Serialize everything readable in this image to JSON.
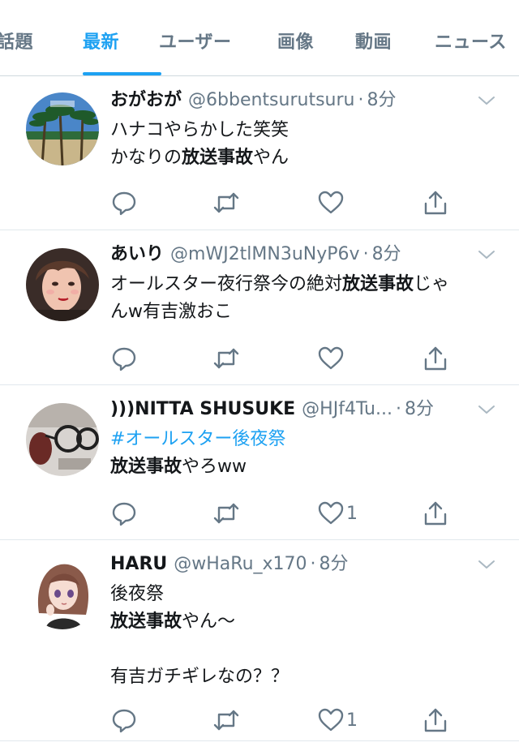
{
  "tabs": [
    {
      "label": "話題",
      "active": false
    },
    {
      "label": "最新",
      "active": true
    },
    {
      "label": "ユーザー",
      "active": false
    },
    {
      "label": "画像",
      "active": false
    },
    {
      "label": "動画",
      "active": false
    },
    {
      "label": "ニュース",
      "active": false
    }
  ],
  "colors": {
    "accent": "#1da1f2",
    "text": "#14171a",
    "muted": "#657786",
    "divider": "#e1e8ed"
  },
  "tweets": [
    {
      "name": "おがおが",
      "handle": "@6bbentsurutsuru",
      "separator": "·",
      "time": "8分",
      "avatar_icon": "palm-trees-beach-avatar",
      "lines": [
        {
          "a": "ハナコやらかした笑笑",
          "b": "",
          "c": ""
        },
        {
          "a": "かなりの",
          "b": "放送事故",
          "c": "やん"
        }
      ],
      "likes": ""
    },
    {
      "name": "あいり",
      "handle": "@mWJ2tlMN3uNyP6v",
      "separator": "·",
      "time": "8分",
      "avatar_icon": "woman-portrait-avatar",
      "lines": [
        {
          "a": "オールスター夜行祭今の絶対",
          "b": "放送事故",
          "c": "じゃ"
        },
        {
          "a": "んw有吉激おこ",
          "b": "",
          "c": ""
        }
      ],
      "likes": ""
    },
    {
      "name": ")))NITTA SHUSUKE",
      "handle": "@HJf4Tu...",
      "separator": "·",
      "time": "8分",
      "avatar_icon": "glasses-photo-avatar",
      "hashtag": "#オールスター後夜祭",
      "lines": [
        {
          "a": "",
          "b": "放送事故",
          "c": "やろww"
        }
      ],
      "likes": "1"
    },
    {
      "name": "HARU",
      "handle": "@wHaRu_x170",
      "separator": "·",
      "time": "8分",
      "avatar_icon": "anime-girl-avatar",
      "lines": [
        {
          "a": "後夜祭",
          "b": "",
          "c": ""
        },
        {
          "a": "",
          "b": "放送事故",
          "c": "やん〜"
        },
        {
          "a": "",
          "b": "",
          "c": ""
        },
        {
          "a": "有吉ガチギレなの？？",
          "b": "",
          "c": ""
        }
      ],
      "likes": "1"
    }
  ]
}
